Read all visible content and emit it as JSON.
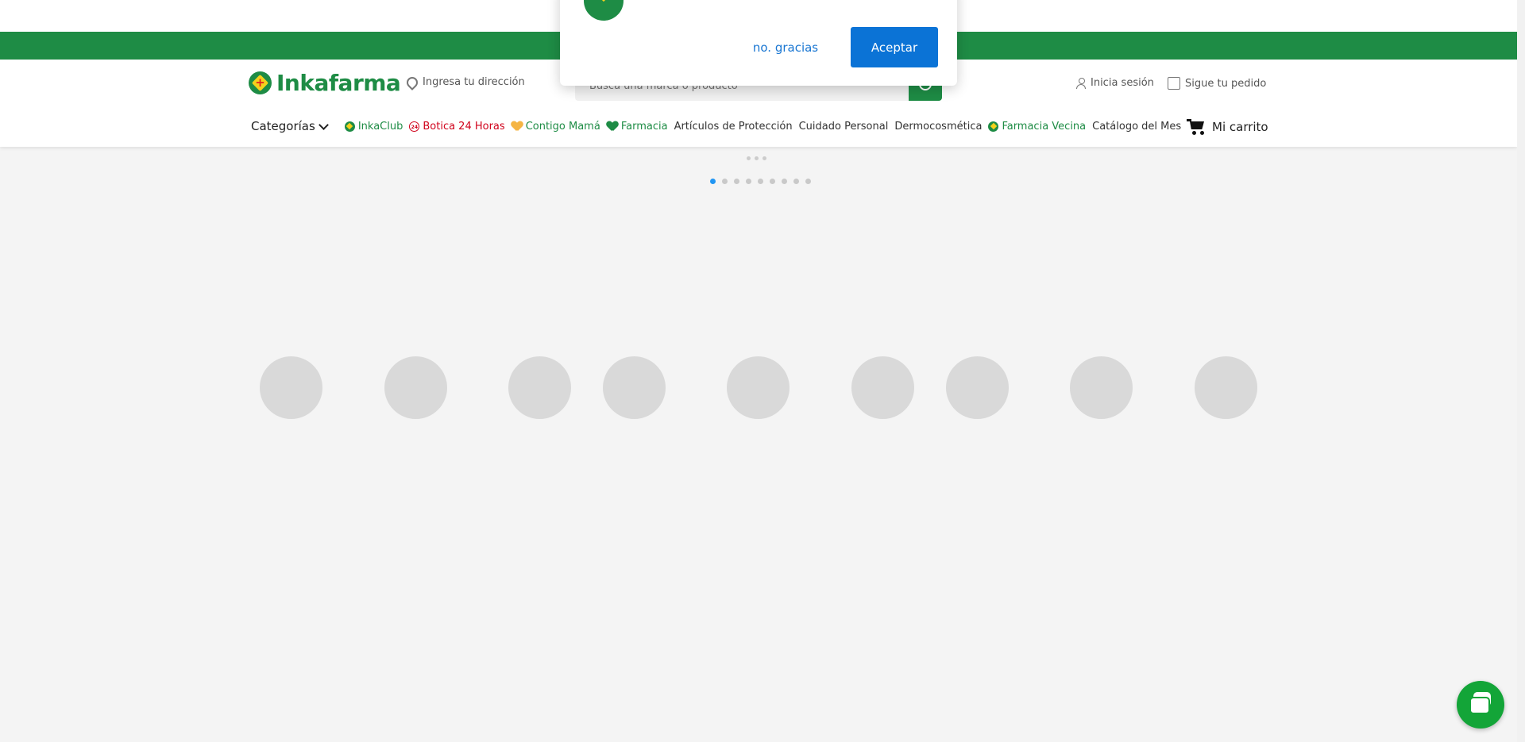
{
  "brand": {
    "name": "Inkafarma"
  },
  "header": {
    "address_label": "Ingresa tu dirección",
    "search_placeholder": "Busca una marca o producto",
    "login_label": "Inicia sesión",
    "track_order_label": "Sigue tu pedido",
    "cart_label": "Mi carrito"
  },
  "nav": {
    "categories_label": "Categorías",
    "items": [
      {
        "label": "InkaClub",
        "icon": "inkaclub-icon"
      },
      {
        "label": "Botica 24 Horas",
        "icon": "24h-icon",
        "badge": "24"
      },
      {
        "label": "Contigo Mamá",
        "icon": "heart-icon"
      },
      {
        "label": "Farmacia",
        "icon": "heart-pulse-icon"
      },
      {
        "label": "Artículos de Protección"
      },
      {
        "label": "Cuidado Personal"
      },
      {
        "label": "Dermocosmética"
      },
      {
        "label": "Farmacia Vecina",
        "icon": "inkafarma-icon"
      },
      {
        "label": "Catálogo del Mes"
      }
    ]
  },
  "carousel": {
    "active_index": 0,
    "total": 9
  },
  "modal": {
    "decline_label": "no. gracias",
    "accept_label": "Aceptar"
  },
  "colors": {
    "brand_green": "#1e8c45",
    "accent_red": "#d0021b",
    "accept_blue": "#0b73d6",
    "chat_green": "#13a538"
  }
}
